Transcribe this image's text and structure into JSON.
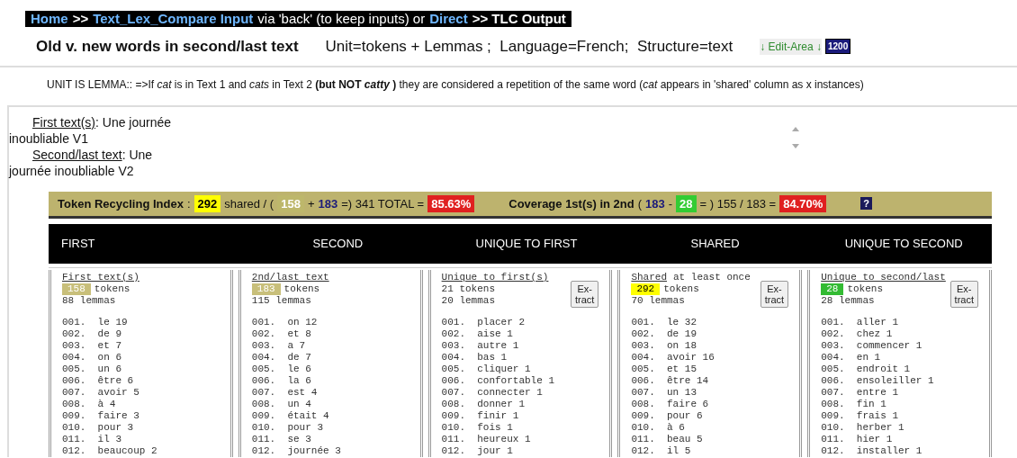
{
  "nav": [
    {
      "kind": "link",
      "text": "Home"
    },
    {
      "kind": "bold",
      "text": ">>"
    },
    {
      "kind": "link",
      "text": "Text_Lex_Compare Input"
    },
    {
      "kind": "text",
      "text": "via 'back' (to keep inputs) or"
    },
    {
      "kind": "link",
      "text": "Direct"
    },
    {
      "kind": "bold",
      "text": ">> TLC Output"
    }
  ],
  "title": "Old v. new words in second/last text",
  "settings": "Unit=tokens + Lemmas ;  Language=French;  Structure=text",
  "edit_link": "↓ Edit-Area ↓",
  "width_badge": "1200",
  "note": "UNIT IS LEMMA:: =>If *cat* is in Text 1 and *cats* in Text 2 **(but NOT *catty* )** they are considered a repetition of the same word (*cat* appears in 'shared' column as x instances)",
  "texts": [
    {
      "label": "First text(s)",
      "value": ": Une journée inoubliable V1"
    },
    {
      "label": "Second/last text",
      "value": ": Une journée inoubliable V2"
    }
  ],
  "stats": [
    {
      "kind": "label",
      "text": "Token Recycling Index"
    },
    {
      "kind": "text",
      "text": ":"
    },
    {
      "kind": "badge",
      "text": "292",
      "color": "#ffff00"
    },
    {
      "kind": "text",
      "text": "shared / ("
    },
    {
      "kind": "badge",
      "text": "158",
      "color": "#bdb76b"
    },
    {
      "kind": "text",
      "text": "+"
    },
    {
      "kind": "num",
      "text": "183"
    },
    {
      "kind": "text",
      "text": "=) 341 TOTAL ="
    },
    {
      "kind": "badge",
      "text": "85.63%",
      "color": "#e02020"
    },
    {
      "kind": "gap"
    },
    {
      "kind": "label",
      "text": "Coverage 1st(s) in 2nd"
    },
    {
      "kind": "text",
      "text": "("
    },
    {
      "kind": "num",
      "text": "183"
    },
    {
      "kind": "text",
      "text": "-"
    },
    {
      "kind": "badge",
      "text": "28",
      "color": "#33cc33"
    },
    {
      "kind": "text",
      "text": "= ) 155 / 183 ="
    },
    {
      "kind": "badge",
      "text": "84.70%",
      "color": "#e02020"
    },
    {
      "kind": "gap"
    },
    {
      "kind": "help",
      "text": "?"
    }
  ],
  "headers": [
    "FIRST",
    "SECOND",
    "UNIQUE TO FIRST",
    "SHARED",
    "UNIQUE TO SECOND"
  ],
  "columns": [
    {
      "title": "First text(s)",
      "count": "158",
      "color": "#c8bf7a",
      "tokens": "tokens",
      "lemmas": "88 lemmas",
      "items": [
        "001.  le 19",
        "002.  de 9",
        "003.  et 7",
        "004.  on 6",
        "005.  un 6",
        "006.  être 6",
        "007.  avoir 5",
        "008.  à 4",
        "009.  faire 3",
        "010.  pour 3",
        "011.  il 3",
        "012.  beaucoup 2"
      ]
    },
    {
      "title": "2nd/last text",
      "count": "183",
      "color": "#c8bf7a",
      "tokens": "tokens",
      "lemmas": "115 lemmas",
      "items": [
        "001.  on 12",
        "002.  et 8",
        "003.  a 7",
        "004.  de 7",
        "005.  le 6",
        "006.  la 6",
        "007.  est 4",
        "008.  un 4",
        "009.  était 4",
        "010.  pour 3",
        "011.  se 3",
        "012.  journée 3"
      ]
    },
    {
      "title": "Unique to first(s)",
      "tokens": "21 tokens",
      "lemmas": "20 lemmas",
      "button": "Ex-\ntract",
      "items": [
        "001.  placer 2",
        "002.  aise 1",
        "003.  autre 1",
        "004.  bas 1",
        "005.  cliquer 1",
        "006.  confortable 1",
        "007.  connecter 1",
        "008.  donner 1",
        "009.  finir 1",
        "010.  fois 1",
        "011.  heureux 1",
        "012.  jour 1"
      ]
    },
    {
      "title": "Shared",
      "title_rest": "at least once",
      "count": "292",
      "color": "#ffff00",
      "tokens": "tokens",
      "lemmas": "70 lemmas",
      "button": "Ex-\ntract",
      "items": [
        "001.  le 32",
        "002.  de 19",
        "003.  on 18",
        "004.  avoir 16",
        "005.  et 15",
        "006.  être 14",
        "007.  un 13",
        "008.  faire 6",
        "009.  pour 6",
        "010.  à 6",
        "011.  beau 5",
        "012.  il 5"
      ]
    },
    {
      "title": "Unique to second/last",
      "count": "28",
      "color": "#33bb33",
      "tokens": "tokens",
      "lemmas": "28 lemmas",
      "button": "Ex-\ntract",
      "items": [
        "001.  aller 1",
        "002.  chez 1",
        "003.  commencer 1",
        "004.  en 1",
        "005.  endroit 1",
        "006.  ensoleiller 1",
        "007.  entre 1",
        "008.  fin 1",
        "009.  frais 1",
        "010.  herber 1",
        "011.  hier 1",
        "012.  installer 1"
      ]
    }
  ]
}
